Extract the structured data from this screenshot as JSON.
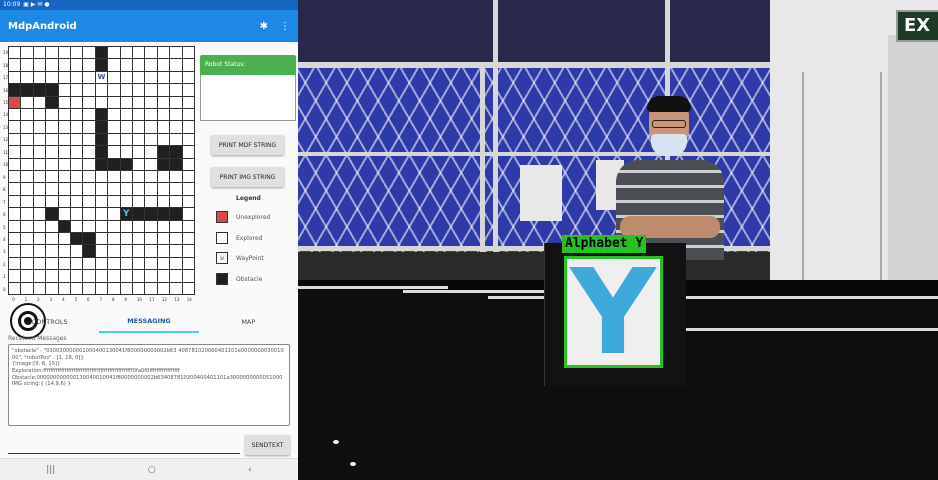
{
  "statusbar": {
    "time": "10:09",
    "icons": "▣ ▶ ✉ ●"
  },
  "app": {
    "title": "MdpAndroid"
  },
  "map": {
    "rows": 20,
    "cols": 15,
    "row_labels": [
      "19",
      "18",
      "17",
      "16",
      "15",
      "14",
      "13",
      "12",
      "11",
      "10",
      "9",
      "8",
      "7",
      "6",
      "5",
      "4",
      "3",
      "2",
      "1",
      "0"
    ],
    "col_labels": [
      "0",
      "1",
      "2",
      "3",
      "4",
      "5",
      "6",
      "7",
      "8",
      "9",
      "10",
      "11",
      "12",
      "13",
      "14"
    ],
    "obstacles": [
      [
        0,
        7
      ],
      [
        1,
        7
      ],
      [
        3,
        0
      ],
      [
        3,
        1
      ],
      [
        3,
        2
      ],
      [
        3,
        3
      ],
      [
        4,
        3
      ],
      [
        5,
        7
      ],
      [
        6,
        7
      ],
      [
        7,
        7
      ],
      [
        8,
        7
      ],
      [
        8,
        12
      ],
      [
        8,
        13
      ],
      [
        9,
        7
      ],
      [
        9,
        8
      ],
      [
        9,
        9
      ],
      [
        9,
        12
      ],
      [
        9,
        13
      ],
      [
        13,
        3
      ],
      [
        13,
        10
      ],
      [
        13,
        11
      ],
      [
        13,
        12
      ],
      [
        13,
        13
      ],
      [
        14,
        4
      ],
      [
        15,
        5
      ],
      [
        15,
        6
      ],
      [
        16,
        6
      ]
    ],
    "unexplored": [
      [
        4,
        0
      ]
    ],
    "image": {
      "row": 13,
      "col": 9,
      "label": "Y"
    },
    "waypoint": {
      "row": 2,
      "col": 7,
      "label": "W"
    }
  },
  "robot_status": {
    "header": "Robot Status:",
    "text": ""
  },
  "buttons": {
    "print_mdf": "PRINT MDF STRING",
    "print_img": "PRINT IMG STRING",
    "send": "SENDTEXT"
  },
  "legend": {
    "title": "Legend",
    "unexplored": "Unexplored",
    "explored": "Explored",
    "waypoint": "WayPoint",
    "waypoint_swatch": "W",
    "obstacle": "Obstacle",
    "colors": {
      "unexplored": "#d84a4a",
      "explored": "#ffffff",
      "obstacle": "#202020"
    }
  },
  "tabs": [
    {
      "label": "CONTROLS",
      "active": false
    },
    {
      "label": "MESSAGING",
      "active": true
    },
    {
      "label": "MAP",
      "active": false
    }
  ],
  "messages": {
    "label": "Received Messages",
    "lines": [
      "\"obstacle\" : \"030030000001000400130041f800000003002b63 408781020060401101e000000003001000\", \"robotPos\" : [1, 18, 0]}",
      "{image:[9, 6, 15]}",
      "Exploration:ffffffffffffffffffffffffffffffffffffffffffffffffff0fa0f0fffffffffffffffff",
      "Obstacle:000000000000130040010041f80000000002b634087810200400401101a3000000000051000",
      "IMG string:{ (14,9,6) }"
    ]
  },
  "navbar": {
    "recent": "|||",
    "home": "○",
    "back": "‹"
  },
  "camera": {
    "detection_label": "Alphabet Y",
    "card_letter": "Y",
    "exit_sign": "EX"
  }
}
